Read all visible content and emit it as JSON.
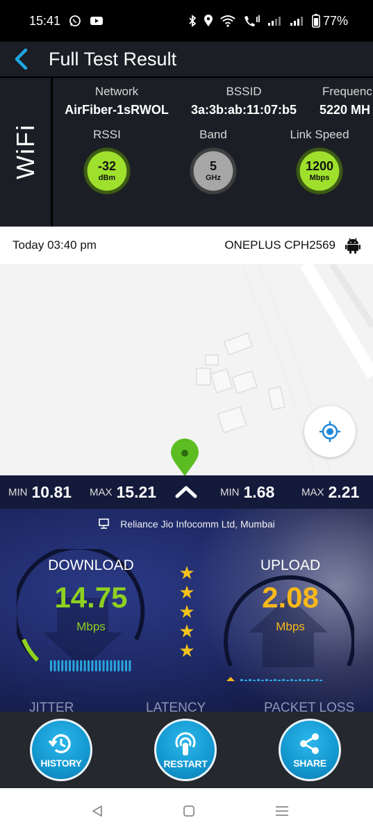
{
  "status_bar": {
    "time": "15:41",
    "battery": "77%",
    "icons": [
      "whatsapp-icon",
      "youtube-icon",
      "bluetooth-icon",
      "location-icon",
      "wifi-icon",
      "call-icon",
      "signal-icon",
      "signal-icon",
      "battery-icon"
    ]
  },
  "header": {
    "title": "Full Test Result"
  },
  "wifi": {
    "side_label": "WiFi",
    "network": {
      "label": "Network",
      "value": "AirFiber-1sRWOL"
    },
    "bssid": {
      "label": "BSSID",
      "value": "3a:3b:ab:11:07:b5"
    },
    "frequency": {
      "label": "Frequenc",
      "value": "5220 MH"
    },
    "rssi": {
      "label": "RSSI",
      "value": "-32",
      "unit": "dBm"
    },
    "band": {
      "label": "Band",
      "value": "5",
      "unit": "GHz"
    },
    "link_speed": {
      "label": "Link Speed",
      "value": "1200",
      "unit": "Mbps"
    }
  },
  "test_info": {
    "date": "Today 03:40 pm",
    "device": "ONEPLUS CPH2569"
  },
  "minmax": {
    "download": {
      "min_label": "MIN",
      "min": "10.81",
      "max_label": "MAX",
      "max": "15.21"
    },
    "upload": {
      "min_label": "MIN",
      "min": "1.68",
      "max_label": "MAX",
      "max": "2.21"
    }
  },
  "speed": {
    "provider": "Reliance Jio Infocomm Ltd, Mumbai",
    "download": {
      "title": "DOWNLOAD",
      "value": "14.75",
      "unit": "Mbps",
      "color": "#8ed11f"
    },
    "upload": {
      "title": "UPLOAD",
      "value": "2.08",
      "unit": "Mbps",
      "color": "#f8b81b"
    },
    "rating": 5,
    "metrics": [
      "JITTER",
      "LATENCY",
      "PACKET LOSS"
    ]
  },
  "actions": [
    {
      "label": "HISTORY",
      "icon": "history-icon"
    },
    {
      "label": "RESTART",
      "icon": "restart-icon"
    },
    {
      "label": "SHARE",
      "icon": "share-icon"
    }
  ]
}
